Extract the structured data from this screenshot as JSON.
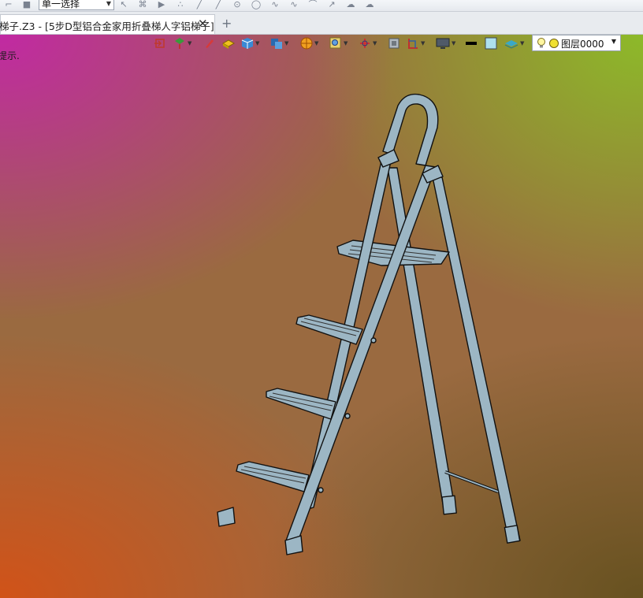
{
  "toolbar": {
    "select_mode": "单一选择",
    "icons": [
      "sketch-icon",
      "stop-icon",
      "pick-icon",
      "filter-icon",
      "play-icon",
      "point-icon",
      "line-icon",
      "arc-icon",
      "circle-icon",
      "curve-icon",
      "spline-icon",
      "trim-icon",
      "pointer-icon",
      "cloud-icon"
    ]
  },
  "tab": {
    "title": "梯子.Z3 - [5步D型铝合金家用折叠梯人字铝梯子]",
    "close_glyph": "✕",
    "add_glyph": "+"
  },
  "viewport": {
    "hint": "提示.",
    "layer": "图层0000",
    "toolbar_icons": [
      "exit-icon",
      "view-orientation-icon",
      "pen-icon",
      "shade-icon",
      "cube-icon",
      "render-icon",
      "palette-icon",
      "zoom-icon",
      "axis-icon",
      "frame-icon",
      "section-icon",
      "display-icon",
      "line-color-icon",
      "fill-color-icon",
      "layer-stack-icon",
      "bulb-icon"
    ],
    "colors": {
      "ladder_fill": "#9cb6c4",
      "ladder_edge": "#111111"
    }
  }
}
